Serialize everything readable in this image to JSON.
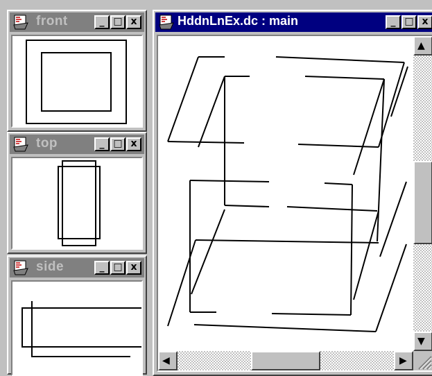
{
  "windows": {
    "front": {
      "title": "front"
    },
    "top": {
      "title": "top"
    },
    "side": {
      "title": "side"
    },
    "main": {
      "title": "HddnLnEx.dc : main"
    }
  },
  "controls": {
    "minimize": "_",
    "maximize": "□",
    "close": "x"
  },
  "scrollbars": {
    "vertical": {
      "up": "▲",
      "down": "▼"
    },
    "horizontal": {
      "left": "◀",
      "right": "▶"
    }
  },
  "colors": {
    "active_title": "#000080",
    "inactive_title": "#808080",
    "window_face": "#c0c0c0",
    "canvas": "#ffffff",
    "ink": "#000000"
  }
}
